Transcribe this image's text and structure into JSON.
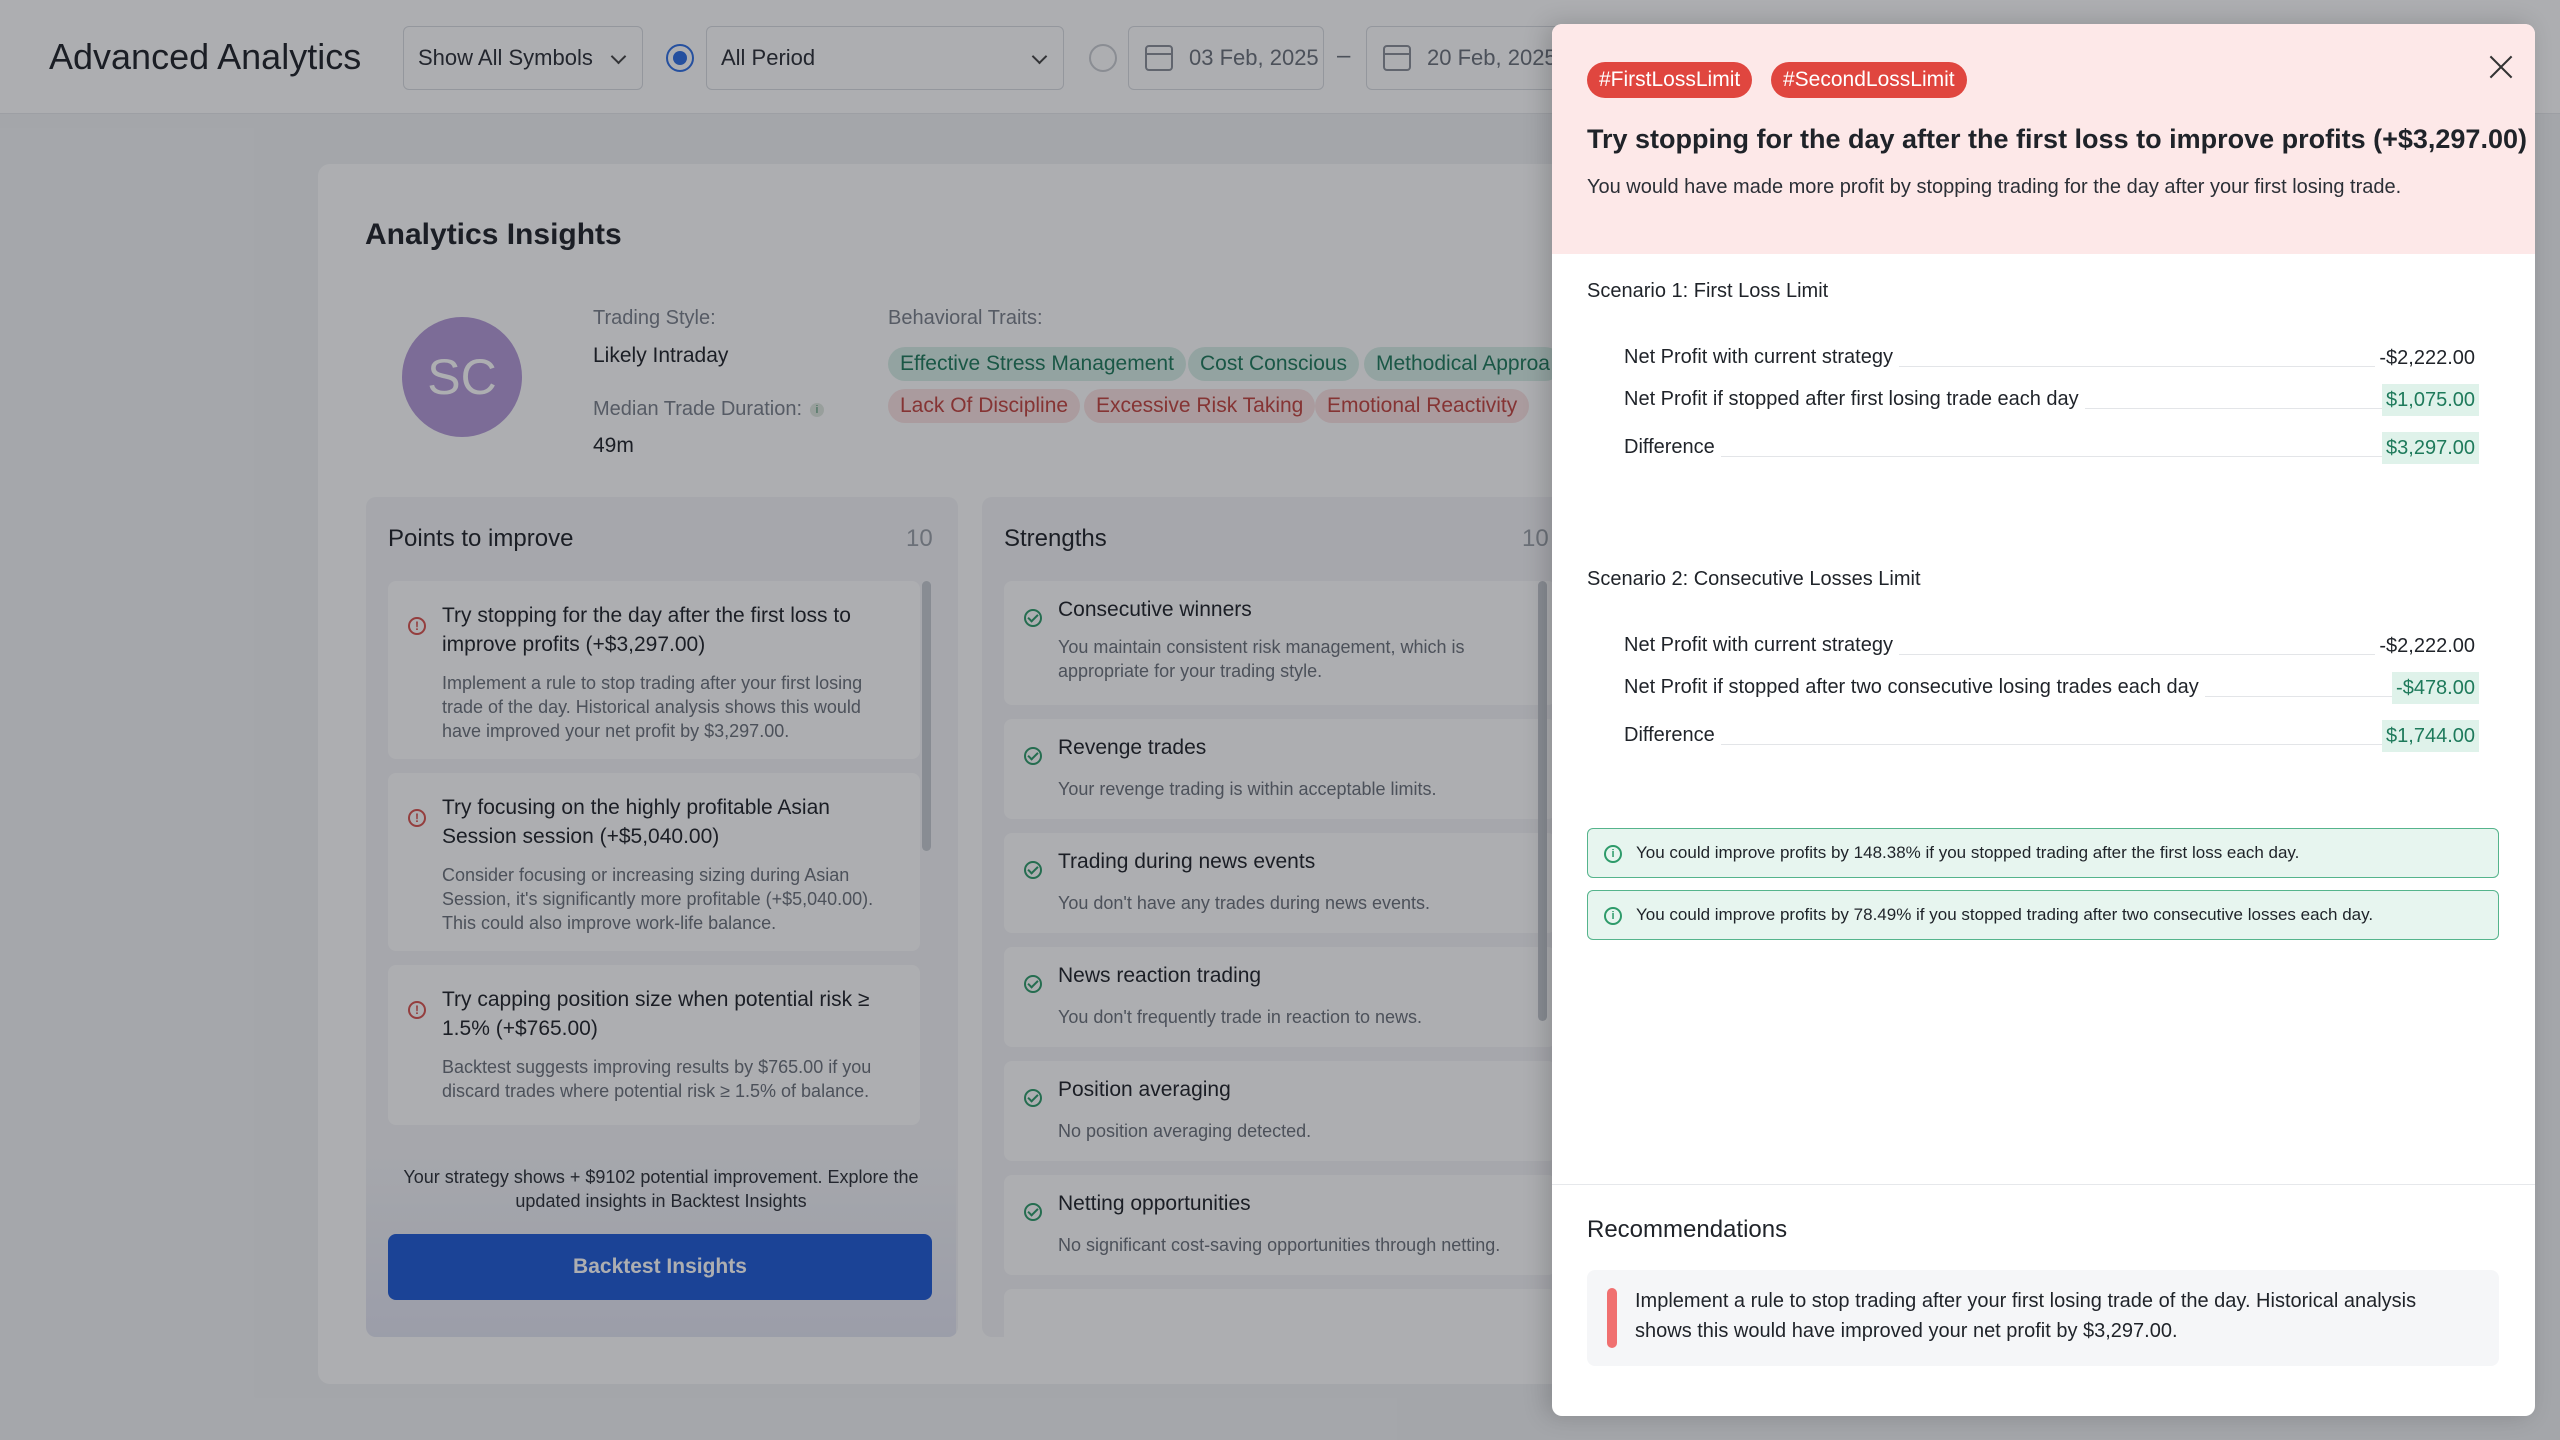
{
  "header": {
    "title": "Advanced Analytics",
    "symbol_select": "Show All Symbols",
    "period_select": "All Period",
    "date_from": "03 Feb, 2025",
    "date_sep": "–",
    "date_to": "20 Feb, 2025"
  },
  "insights": {
    "title": "Analytics Insights",
    "avatar_initials": "SC",
    "trading_style_label": "Trading Style:",
    "trading_style_value": "Likely Intraday",
    "median_label": "Median Trade Duration:",
    "median_value": "49m",
    "traits_label": "Behavioral Traits:",
    "good_traits": [
      "Effective Stress Management",
      "Cost Conscious",
      "Methodical Approa"
    ],
    "bad_traits": [
      "Lack Of Discipline",
      "Excessive Risk Taking",
      "Emotional Reactivity"
    ]
  },
  "improve": {
    "title": "Points to improve",
    "count": "10",
    "items": [
      {
        "title_l1": "Try stopping for the day after the first loss to",
        "title_l2": "improve profits (+$3,297.00)",
        "desc_l1": "Implement a rule to stop trading after your first losing",
        "desc_l2": "trade of the day. Historical analysis shows this would",
        "desc_l3": "have improved your net profit by $3,297.00."
      },
      {
        "title_l1": "Try focusing on the highly profitable Asian",
        "title_l2": "Session session (+$5,040.00)",
        "desc_l1": "Consider focusing or increasing sizing during Asian",
        "desc_l2": "Session, it's significantly more profitable (+$5,040.00).",
        "desc_l3": "This could also improve work-life balance."
      },
      {
        "title_l1": "Try capping position size when potential risk ≥",
        "title_l2": "1.5% (+$765.00)",
        "desc_l1": "Backtest suggests improving results by $765.00 if you",
        "desc_l2": "discard trades where potential risk ≥ 1.5% of balance.",
        "desc_l3": ""
      }
    ],
    "promo": "Your strategy shows + $9102 potential improvement. Explore the updated insights in Backtest Insights",
    "button": "Backtest Insights"
  },
  "strengths": {
    "title": "Strengths",
    "count": "10",
    "items": [
      {
        "title": "Consecutive winners",
        "desc_l1": "You maintain consistent risk management, which is",
        "desc_l2": "appropriate for your trading style."
      },
      {
        "title": "Revenge trades",
        "desc_l1": "Your revenge trading is within acceptable limits.",
        "desc_l2": ""
      },
      {
        "title": "Trading during news events",
        "desc_l1": "You don't have any trades during news events.",
        "desc_l2": ""
      },
      {
        "title": "News reaction trading",
        "desc_l1": "You don't frequently trade in reaction to news.",
        "desc_l2": ""
      },
      {
        "title": "Position averaging",
        "desc_l1": "No position averaging detected.",
        "desc_l2": ""
      },
      {
        "title": "Netting opportunities",
        "desc_l1": "No significant cost-saving opportunities through netting.",
        "desc_l2": ""
      }
    ]
  },
  "drawer": {
    "tags": [
      "#FirstLossLimit",
      "#SecondLossLimit"
    ],
    "title": "Try stopping for the day after the first loss to improve profits (+$3,297.00)",
    "subtitle": "You would have made more profit by stopping trading for the day after your first losing trade.",
    "scenario1": {
      "title": "Scenario 1: First Loss Limit",
      "rows": [
        {
          "label": "Net Profit with current strategy",
          "value": "-$2,222.00"
        },
        {
          "label": "Net Profit if stopped after first losing trade each day",
          "value": "$1,075.00"
        },
        {
          "label": "Difference",
          "value": "$3,297.00"
        }
      ]
    },
    "scenario2": {
      "title": "Scenario 2: Consecutive Losses Limit",
      "rows": [
        {
          "label": "Net Profit with current strategy",
          "value": "-$2,222.00"
        },
        {
          "label": "Net Profit if stopped after two consecutive losing trades each day",
          "value": "-$478.00"
        },
        {
          "label": "Difference",
          "value": "$1,744.00"
        }
      ]
    },
    "notes": [
      "You could improve profits by 148.38% if you stopped trading after the first loss each day.",
      "You could improve profits by 78.49% if you stopped trading after two consecutive losses each day."
    ],
    "recommendations_title": "Recommendations",
    "recommendation": "Implement a rule to stop trading after your first losing trade of the day. Historical analysis shows this would have improved your net profit by $3,297.00."
  },
  "colors": {
    "accent": "#1f5bd6",
    "danger": "#e0463f",
    "success": "#1e7a5b"
  }
}
